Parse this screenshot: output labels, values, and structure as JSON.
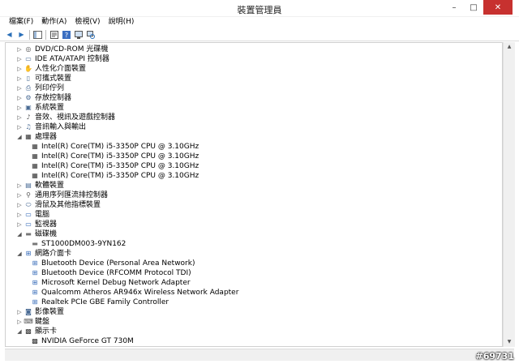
{
  "window": {
    "title": "裝置管理員",
    "min_label": "–",
    "max_label": "□",
    "close_label": "✕"
  },
  "menu": [
    "檔案(F)",
    "動作(A)",
    "檢視(V)",
    "說明(H)"
  ],
  "toolbar": {
    "back_label": "◀",
    "forward_label": "▶"
  },
  "tree": [
    {
      "label": "DVD/CD-ROM 光碟機",
      "icon": "disc-drive-icon",
      "expander": "▷",
      "level": 0
    },
    {
      "label": "IDE ATA/ATAPI 控制器",
      "icon": "ide-controller-icon",
      "expander": "▷",
      "level": 0
    },
    {
      "label": "人性化介面裝置",
      "icon": "hid-icon",
      "expander": "▷",
      "level": 0
    },
    {
      "label": "可攜式裝置",
      "icon": "portable-device-icon",
      "expander": "▷",
      "level": 0
    },
    {
      "label": "列印佇列",
      "icon": "printer-icon",
      "expander": "▷",
      "level": 0
    },
    {
      "label": "存放控制器",
      "icon": "storage-controller-icon",
      "expander": "▷",
      "level": 0
    },
    {
      "label": "系統裝置",
      "icon": "system-device-icon",
      "expander": "▷",
      "level": 0
    },
    {
      "label": "音效、視訊及遊戲控制器",
      "icon": "audio-icon",
      "expander": "▷",
      "level": 0
    },
    {
      "label": "音訊輸入與輸出",
      "icon": "audio-io-icon",
      "expander": "▷",
      "level": 0
    },
    {
      "label": "處理器",
      "icon": "processor-icon",
      "expander": "◢",
      "level": 0
    },
    {
      "label": "Intel(R) Core(TM) i5-3350P CPU @ 3.10GHz",
      "icon": "processor-icon",
      "expander": "",
      "level": 1
    },
    {
      "label": "Intel(R) Core(TM) i5-3350P CPU @ 3.10GHz",
      "icon": "processor-icon",
      "expander": "",
      "level": 1
    },
    {
      "label": "Intel(R) Core(TM) i5-3350P CPU @ 3.10GHz",
      "icon": "processor-icon",
      "expander": "",
      "level": 1
    },
    {
      "label": "Intel(R) Core(TM) i5-3350P CPU @ 3.10GHz",
      "icon": "processor-icon",
      "expander": "",
      "level": 1
    },
    {
      "label": "軟體裝置",
      "icon": "software-device-icon",
      "expander": "▷",
      "level": 0
    },
    {
      "label": "通用序列匯流排控制器",
      "icon": "usb-icon",
      "expander": "▷",
      "level": 0
    },
    {
      "label": "滑鼠及其他指標裝置",
      "icon": "mouse-icon",
      "expander": "▷",
      "level": 0
    },
    {
      "label": "電腦",
      "icon": "computer-icon",
      "expander": "▷",
      "level": 0
    },
    {
      "label": "監視器",
      "icon": "monitor-icon",
      "expander": "▷",
      "level": 0
    },
    {
      "label": "磁碟機",
      "icon": "disk-drive-icon",
      "expander": "◢",
      "level": 0
    },
    {
      "label": "ST1000DM003-9YN162",
      "icon": "disk-drive-icon",
      "expander": "",
      "level": 1
    },
    {
      "label": "網路介面卡",
      "icon": "network-adapter-icon",
      "expander": "◢",
      "level": 0
    },
    {
      "label": "Bluetooth Device (Personal Area Network)",
      "icon": "network-adapter-icon",
      "expander": "",
      "level": 1
    },
    {
      "label": "Bluetooth Device (RFCOMM Protocol TDI)",
      "icon": "network-adapter-icon",
      "expander": "",
      "level": 1
    },
    {
      "label": "Microsoft Kernel Debug Network Adapter",
      "icon": "network-adapter-icon",
      "expander": "",
      "level": 1
    },
    {
      "label": "Qualcomm Atheros AR946x Wireless Network Adapter",
      "icon": "network-adapter-icon",
      "expander": "",
      "level": 1
    },
    {
      "label": "Realtek PCIe GBE Family Controller",
      "icon": "network-adapter-icon",
      "expander": "",
      "level": 1
    },
    {
      "label": "影像裝置",
      "icon": "imaging-device-icon",
      "expander": "▷",
      "level": 0
    },
    {
      "label": "鍵盤",
      "icon": "keyboard-icon",
      "expander": "▷",
      "level": 0
    },
    {
      "label": "顯示卡",
      "icon": "display-adapter-icon",
      "expander": "◢",
      "level": 0
    },
    {
      "label": "NVIDIA GeForce GT 730M",
      "icon": "display-adapter-icon",
      "expander": "",
      "level": 1
    }
  ],
  "watermark": "#69731"
}
